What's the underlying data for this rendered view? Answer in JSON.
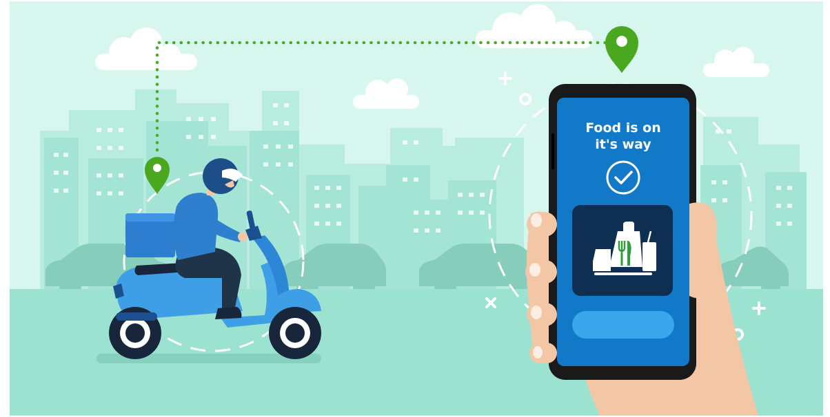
{
  "phone": {
    "title_line1": "Food is on",
    "title_line2": "it's way"
  },
  "colors": {
    "sky": "#d7f6ee",
    "ground": "#9be2d0",
    "buildings_back": "#b8ecdf",
    "buildings_front": "#a4e4d4",
    "car": "#86cdbb",
    "route_dots": "#4ca92b",
    "pin": "#4aa820",
    "phone_body": "#1a1a1a",
    "phone_screen": "#1278c8",
    "food_card": "#0e2f52",
    "screen_button": "#3aa6ec",
    "scooter": "#3e9ee6",
    "scooter_dark": "#1b4f8f",
    "rider_jacket": "#2f7fcf",
    "rider_pants": "#1f3448",
    "helmet": "#1e4e87",
    "skin": "#f3c7a6"
  },
  "icons": [
    "location-pin-icon",
    "checkmark-circle-icon",
    "food-bag-icon",
    "fork-knife-icon",
    "cup-icon",
    "scooter-icon",
    "rider-icon",
    "smartphone-icon",
    "hand-icon",
    "cloud-icon",
    "car-icon",
    "sparkle-plus-icon",
    "sparkle-cross-icon"
  ]
}
